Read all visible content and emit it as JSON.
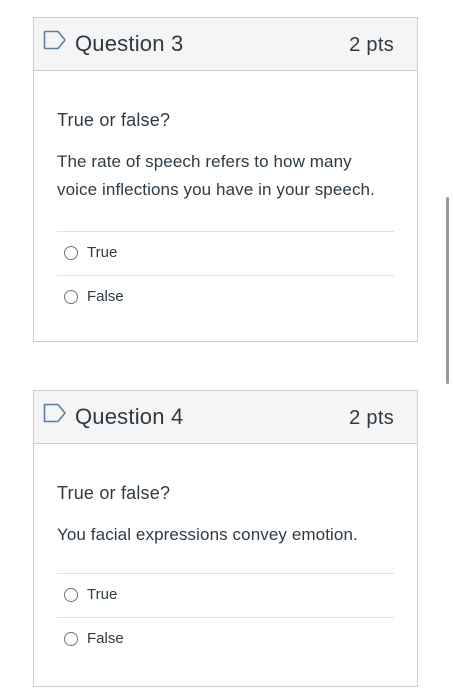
{
  "questions": [
    {
      "title": "Question 3",
      "points": "2 pts",
      "prompt": "True or false?",
      "text_lines": [
        "The rate of speech refers to how many",
        "voice inflections you have in your speech."
      ],
      "options": [
        {
          "label": "True",
          "selected": false
        },
        {
          "label": "False",
          "selected": false
        }
      ]
    },
    {
      "title": "Question 4",
      "points": "2 pts",
      "prompt": "True or false?",
      "text_lines": [
        "You facial expressions convey emotion."
      ],
      "options": [
        {
          "label": "True",
          "selected": false
        },
        {
          "label": "False",
          "selected": false
        }
      ]
    }
  ],
  "icons": {
    "flag": "bookmark-flag-icon",
    "radio": "radio-button-icon"
  },
  "colors": {
    "text": "#2d3b45",
    "border": "#c7cdd1",
    "header_bg": "#f5f5f5",
    "flag": "#5a7fa6"
  }
}
